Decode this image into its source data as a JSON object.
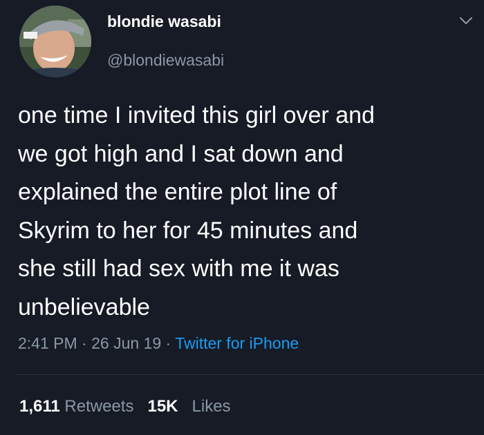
{
  "user": {
    "display_name": "blondie wasabi",
    "handle": "@blondiewasabi",
    "avatar_icon": "profile-photo",
    "menu_icon": "chevron-down-icon"
  },
  "tweet": {
    "text": "one time I invited this girl over and\nwe got high and I sat down and\nexplained the entire plot line of\nSkyrim to her for 45 minutes and\nshe still had sex with me it was\nunbelievable",
    "time": "2:41 PM",
    "separator": "·",
    "date": "26 Jun 19",
    "source": "Twitter for iPhone"
  },
  "stats": {
    "retweets_count": "1,611",
    "retweets_label": "Retweets",
    "likes_count": "15K",
    "likes_label": "Likes"
  },
  "colors": {
    "background": "#161b26",
    "primary_text": "#ffffff",
    "secondary_text": "#8b98a5",
    "link": "#1d9bf0"
  }
}
